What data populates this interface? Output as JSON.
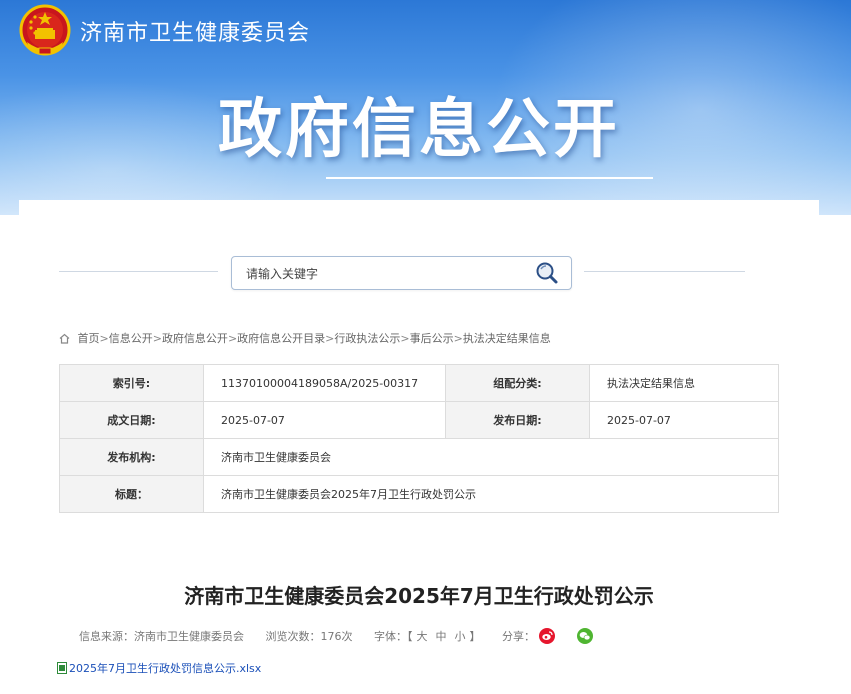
{
  "header": {
    "site_name": "济南市卫生健康委员会",
    "banner_title": "政府信息公开"
  },
  "search": {
    "placeholder": "请输入关键字"
  },
  "breadcrumb": [
    "首页",
    "信息公开",
    "政府信息公开",
    "政府信息公开目录",
    "行政执法公示",
    "事后公示",
    "执法决定结果信息"
  ],
  "breadcrumb_sep": ">",
  "meta": {
    "index_label": "索引号:",
    "index_value": "11370100004189058A/2025-00317",
    "category_label": "组配分类:",
    "category_value": "执法决定结果信息",
    "created_label": "成文日期:",
    "created_value": "2025-07-07",
    "published_label": "发布日期:",
    "published_value": "2025-07-07",
    "agency_label": "发布机构:",
    "agency_value": "济南市卫生健康委员会",
    "title_label": "标题：",
    "title_value": "济南市卫生健康委员会2025年7月卫生行政处罚公示"
  },
  "article": {
    "title": "济南市卫生健康委员会2025年7月卫生行政处罚公示",
    "source": "信息来源：济南市卫生健康委员会",
    "views": "浏览次数：176次",
    "font_label": "字体：【",
    "font_large": "大",
    "font_medium": "中",
    "font_small": "小",
    "font_end": "】",
    "share_label": "分享：",
    "attachment": "2025年7月卫生行政处罚信息公示.xlsx"
  },
  "colors": {
    "banner_top": "#2c78d6",
    "link": "#1a4fb8",
    "weibo": "#e6162d",
    "wechat": "#4fb531"
  }
}
